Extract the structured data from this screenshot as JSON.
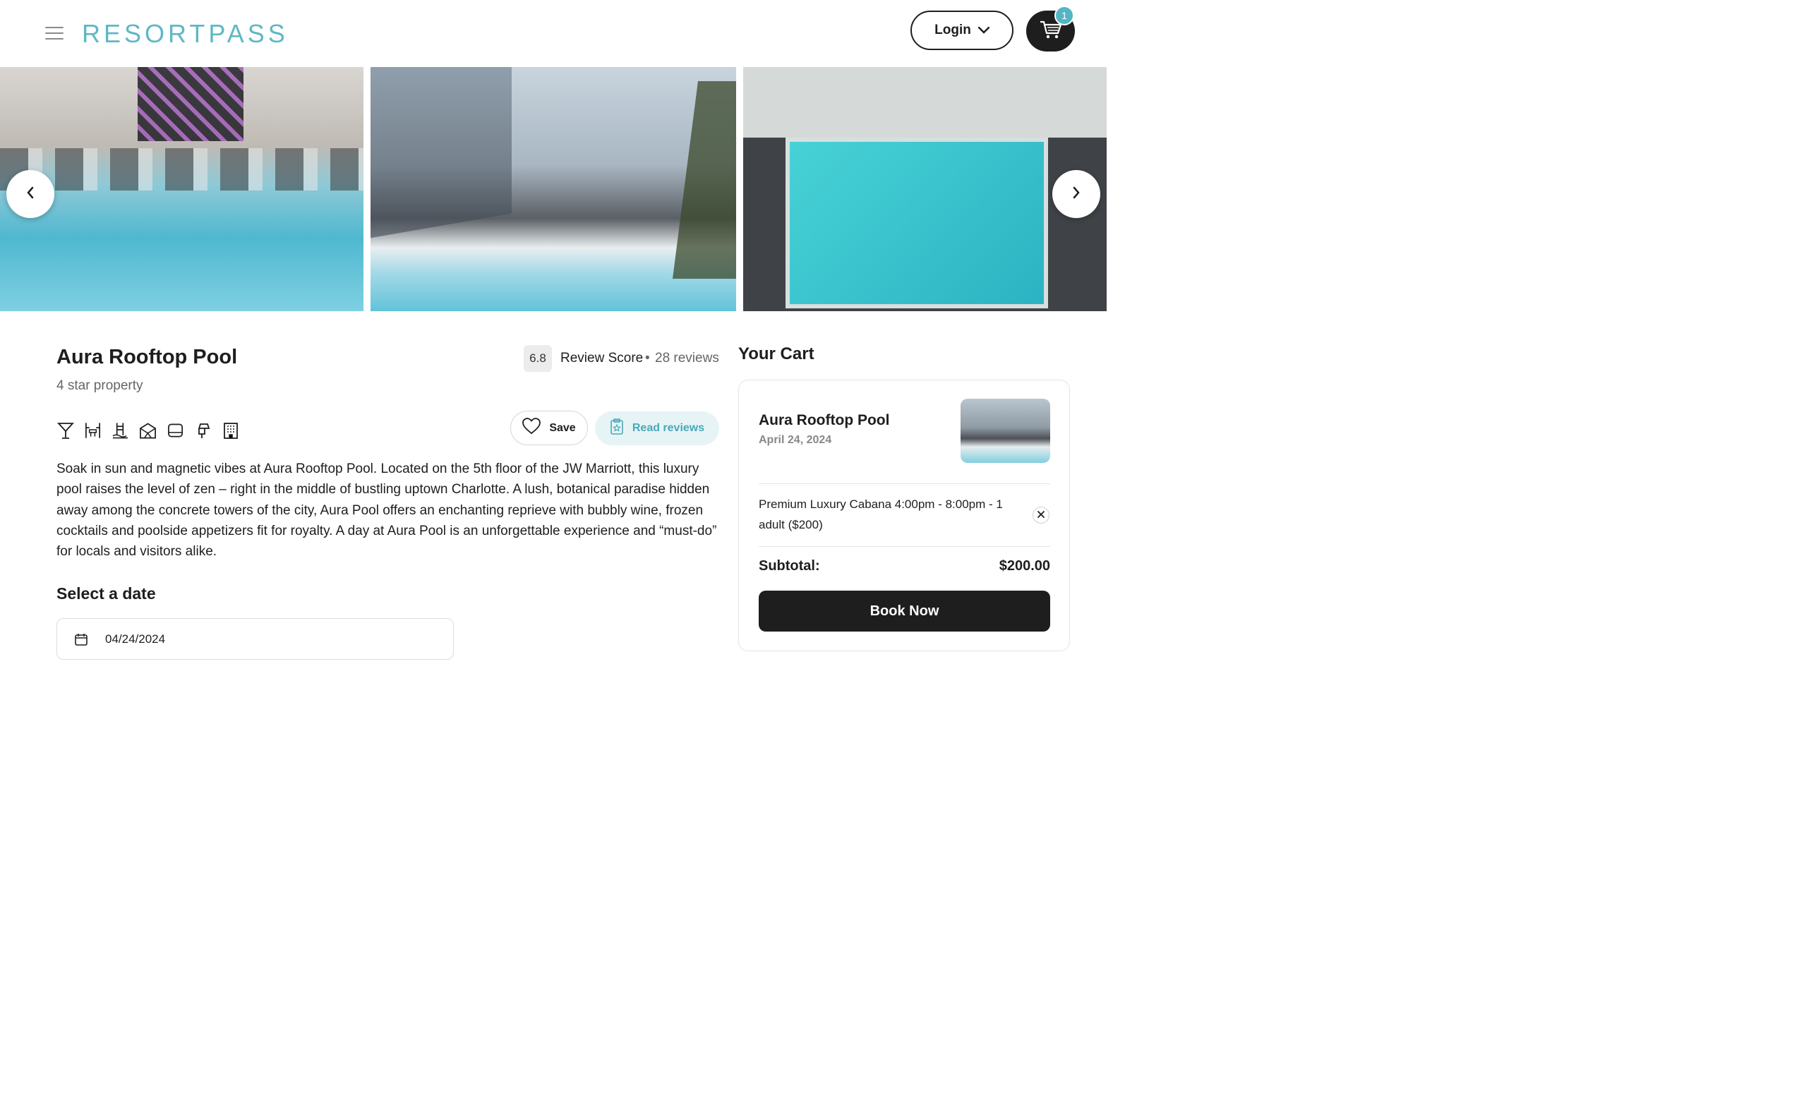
{
  "header": {
    "logo": "RESORTPASS",
    "login_label": "Login",
    "cart_count": "1"
  },
  "gallery": {
    "icons": {
      "prev": "chevron-left-icon",
      "next": "chevron-right-icon"
    }
  },
  "listing": {
    "title": "Aura Rooftop Pool",
    "subtitle": "4 star property",
    "review_score": "6.8",
    "review_label": "Review Score",
    "separator": "•",
    "review_count": "28 reviews",
    "amenities": [
      "cocktail-icon",
      "dining-icon",
      "pool-ladder-icon",
      "cabana-icon",
      "lounger-icon",
      "spa-icon",
      "building-icon"
    ],
    "save_label": "Save",
    "read_reviews_label": "Read reviews",
    "description": "Soak in sun and magnetic vibes at Aura Rooftop Pool. Located on the 5th floor of the JW Marriott, this luxury pool raises the level of zen – right in the middle of bustling uptown Charlotte. A lush, botanical paradise hidden away among the concrete towers of the city, Aura Pool offers an enchanting reprieve with bubbly wine, frozen cocktails and poolside appetizers fit for royalty. A day at Aura Pool is an unforgettable experience and “must-do” for locals and visitors alike."
  },
  "date_picker": {
    "heading": "Select a date",
    "value": "04/24/2024"
  },
  "cart": {
    "heading": "Your Cart",
    "item_title": "Aura Rooftop Pool",
    "item_date": "April 24, 2024",
    "line_item": "Premium Luxury Cabana 4:00pm - 8:00pm - 1 adult ($200)",
    "subtotal_label": "Subtotal:",
    "subtotal_value": "$200.00",
    "book_label": "Book Now"
  },
  "colors": {
    "brand": "#5fb8c3",
    "dark": "#1e1e1e",
    "accent_light": "#e7f4f6"
  }
}
